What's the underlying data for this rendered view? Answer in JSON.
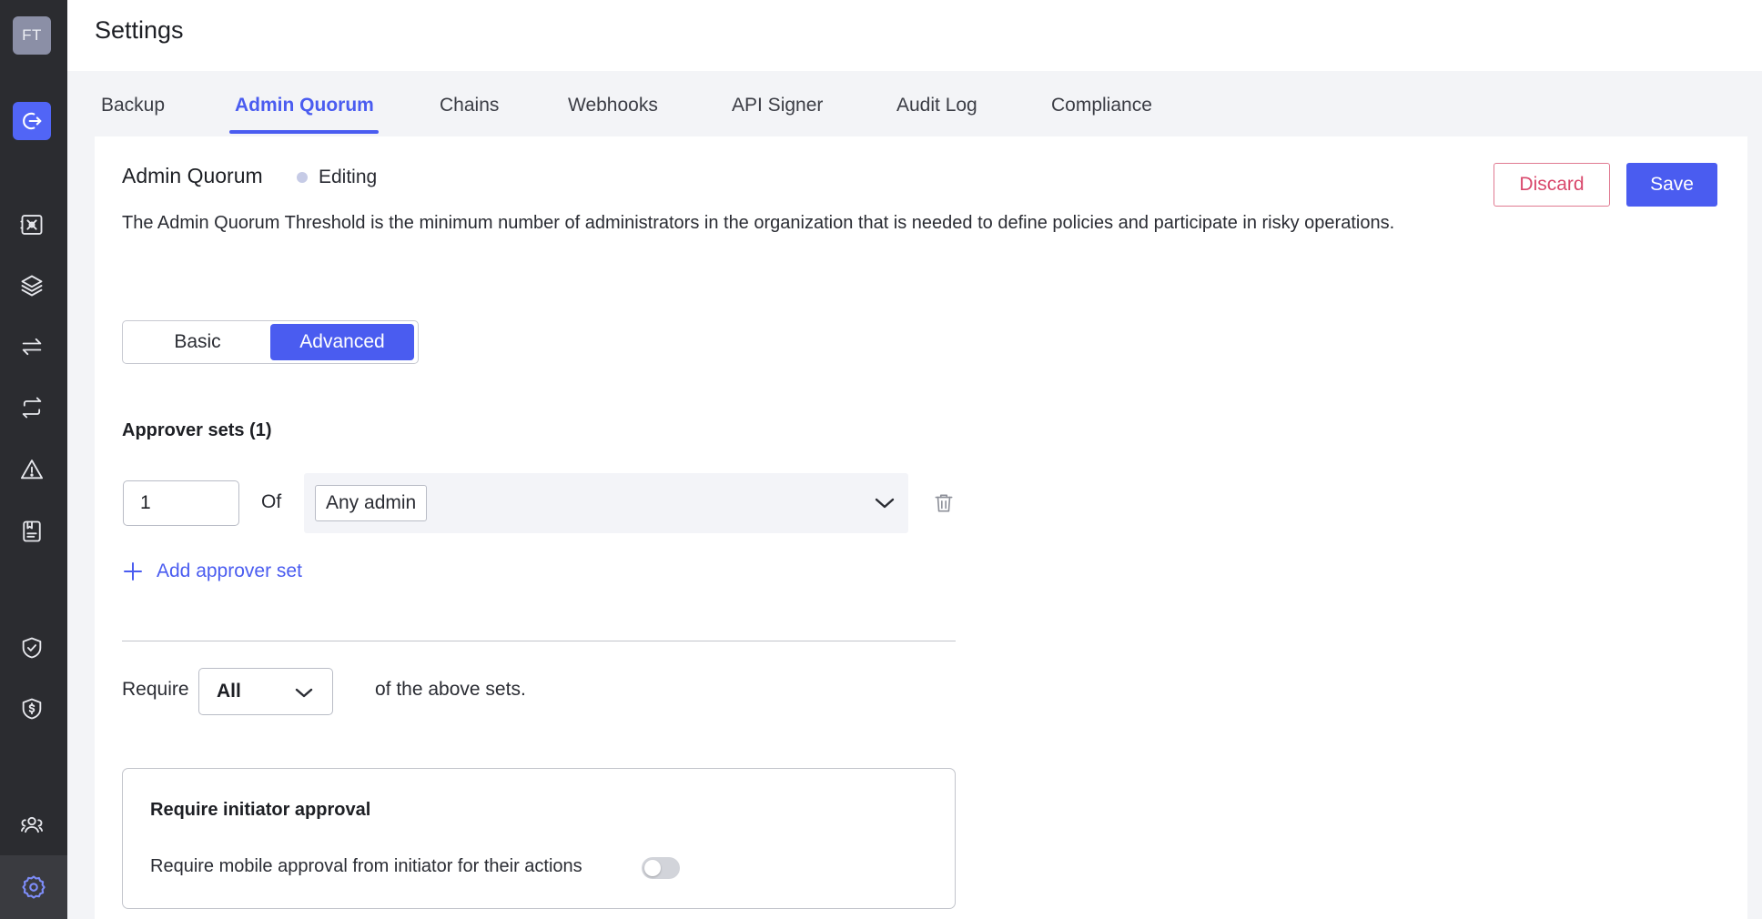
{
  "sidebar": {
    "avatar_initials": "FT",
    "icons": [
      "logout-icon",
      "vault-icon",
      "layers-icon",
      "transfer-icon",
      "exchange-icon",
      "warning-icon",
      "address-book-icon",
      "shield-check-icon",
      "shield-dollar-icon",
      "users-icon",
      "gear-icon"
    ],
    "accent_color": "#5165f6",
    "background_color": "#2b2c30"
  },
  "header": {
    "title": "Settings"
  },
  "tabs": [
    {
      "label": "Backup"
    },
    {
      "label": "Admin Quorum",
      "active": true
    },
    {
      "label": "Chains"
    },
    {
      "label": "Webhooks"
    },
    {
      "label": "API Signer"
    },
    {
      "label": "Audit Log"
    },
    {
      "label": "Compliance"
    }
  ],
  "section": {
    "title": "Admin Quorum",
    "status": "Editing",
    "description": "The Admin Quorum Threshold is the minimum number of administrators in the organization that is needed to define policies and participate in risky operations.",
    "discard_label": "Discard",
    "save_label": "Save"
  },
  "mode": {
    "options": [
      "Basic",
      "Advanced"
    ],
    "selected": "Advanced"
  },
  "approver_sets": {
    "title": "Approver sets (1)",
    "sets": [
      {
        "count": "1",
        "of_label": "Of",
        "group": "Any admin"
      }
    ],
    "add_label": "Add approver set"
  },
  "require": {
    "prefix": "Require",
    "value": "All",
    "suffix": "of the above sets."
  },
  "initiator": {
    "title": "Require initiator approval",
    "toggle_label": "Require mobile approval from initiator for their actions",
    "enabled": false
  },
  "colors": {
    "primary": "#4a5cf0",
    "danger": "#d9486c"
  }
}
